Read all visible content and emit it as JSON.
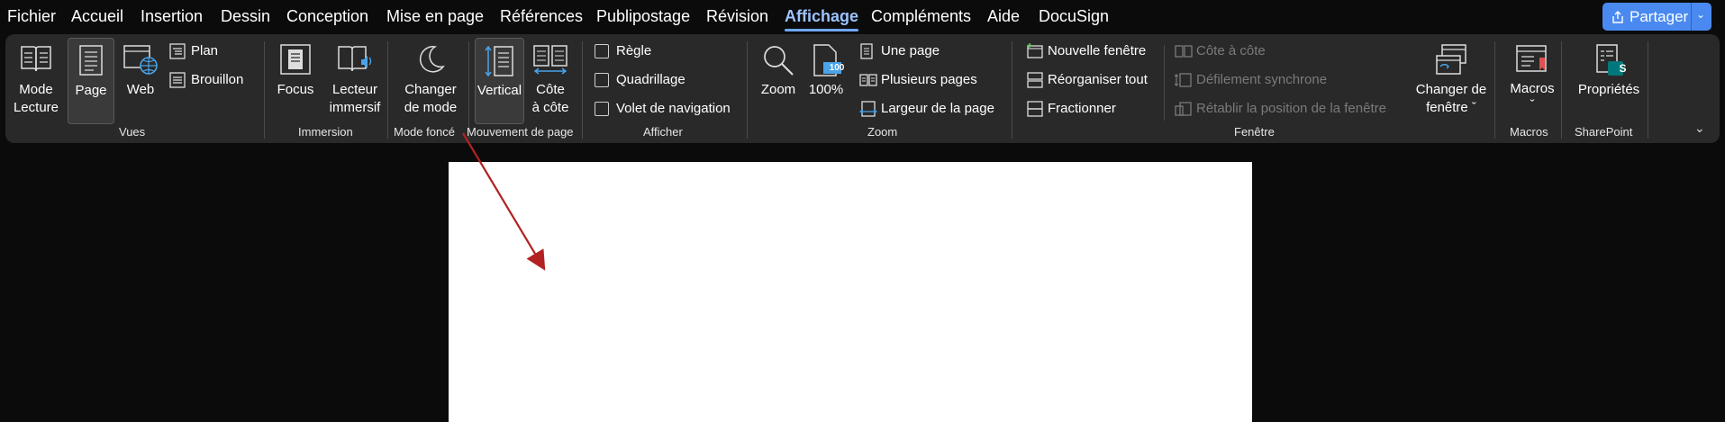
{
  "menu": [
    "Fichier",
    "Accueil",
    "Insertion",
    "Dessin",
    "Conception",
    "Mise en page",
    "Références",
    "Publipostage",
    "Révision",
    "Affichage",
    "Compléments",
    "Aide",
    "DocuSign"
  ],
  "active_menu": "Affichage",
  "share": {
    "label": "Partager"
  },
  "ribbon": {
    "vues": {
      "label": "Vues",
      "mode_lecture": "Mode\nLecture",
      "page": "Page",
      "web": "Web",
      "plan": "Plan",
      "brouillon": "Brouillon"
    },
    "immersion": {
      "label": "Immersion",
      "focus": "Focus",
      "lecteur": "Lecteur\nimmersif"
    },
    "mode_fonce": {
      "label": "Mode foncé",
      "changer": "Changer\nde mode"
    },
    "mouvement": {
      "label": "Mouvement de page",
      "vertical": "Vertical",
      "cote": "Côte\nà côte"
    },
    "afficher": {
      "label": "Afficher",
      "regle": "Règle",
      "quadrillage": "Quadrillage",
      "volet": "Volet de navigation"
    },
    "zoom": {
      "label": "Zoom",
      "zoom": "Zoom",
      "pct": "100%",
      "icon_badge": "100",
      "une_page": "Une page",
      "plusieurs": "Plusieurs pages",
      "largeur": "Largeur de la page"
    },
    "fenetre": {
      "label": "Fenêtre",
      "nouvelle": "Nouvelle fenêtre",
      "reorganiser": "Réorganiser tout",
      "fractionner": "Fractionner",
      "cote_a_cote": "Côte à côte",
      "defilement": "Défilement synchrone",
      "retablir": "Rétablir la position de la fenêtre",
      "changer_fenetre": "Changer de\nfenêtre ˇ"
    },
    "macros": {
      "label": "Macros",
      "macros": "Macros\nˇ"
    },
    "sharepoint": {
      "label": "SharePoint",
      "proprietes": "Propriétés",
      "icon_letter": "S"
    }
  },
  "colors": {
    "accent": "#4a8af0",
    "arrow": "#b22222",
    "ribbon": "#292929",
    "background": "#0b0b0b"
  }
}
